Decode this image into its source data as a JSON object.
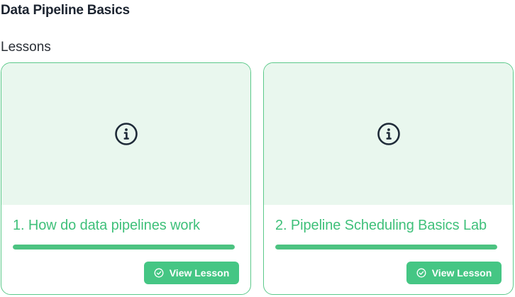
{
  "course": {
    "title": "Data Pipeline Basics",
    "section_label": "Lessons"
  },
  "lessons": [
    {
      "title": "1. How do data pipelines work",
      "progress": 1.0,
      "button_label": "View Lesson",
      "thumbnail_icon": "info-icon",
      "button_icon": "check-circle-icon"
    },
    {
      "title": "2. Pipeline Scheduling Basics Lab",
      "progress": 1.0,
      "button_label": "View Lesson",
      "thumbnail_icon": "info-icon",
      "button_icon": "check-circle-icon"
    }
  ],
  "colors": {
    "accent": "#45c684",
    "title_text": "#3fc07a",
    "thumb_bg": "#e9f7ee",
    "card_border": "#5cc98a"
  }
}
